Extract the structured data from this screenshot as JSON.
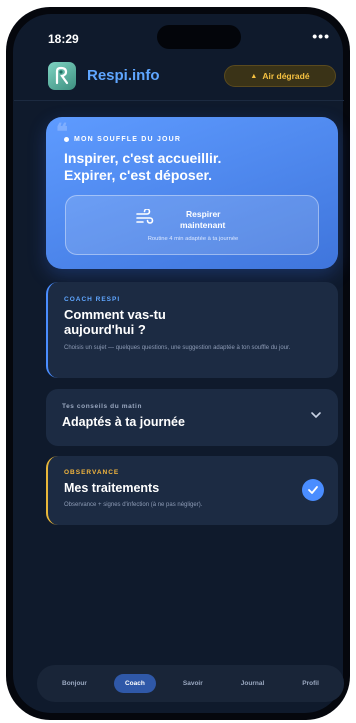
{
  "status": {
    "time": "18:29",
    "more": "•••"
  },
  "header": {
    "title": "Respi.info",
    "air_quality_label": "Air dégradé"
  },
  "hero": {
    "kicker": "MON SOUFFLE DU JOUR",
    "line1": "Inspirer, c'est accueillir.",
    "line2": "Expirer, c'est déposer.",
    "button_line1": "Respirer",
    "button_line2": "maintenant",
    "button_sub": "Routine 4 min adaptée à ta journée"
  },
  "coach": {
    "kicker": "COACH RESPI",
    "title_line1": "Comment vas-tu",
    "title_line2": "aujourd'hui ?",
    "description": "Choisis un sujet — quelques questions, une suggestion adaptée à ton souffle du jour."
  },
  "tips": {
    "kicker": "Tes conseils du matin",
    "title": "Adaptés à ta journée"
  },
  "treatments": {
    "kicker": "OBSERVANCE",
    "title": "Mes traitements",
    "description": "Observance + signes d'infection (à ne pas négliger)."
  },
  "tabs": [
    {
      "label": "Bonjour"
    },
    {
      "label": "Coach"
    },
    {
      "label": "Savoir"
    },
    {
      "label": "Journal"
    },
    {
      "label": "Profil"
    }
  ],
  "active_tab": "Coach",
  "colors": {
    "accent": "#4a8dff",
    "warning": "#f5c141",
    "background": "#0f1a2c"
  }
}
